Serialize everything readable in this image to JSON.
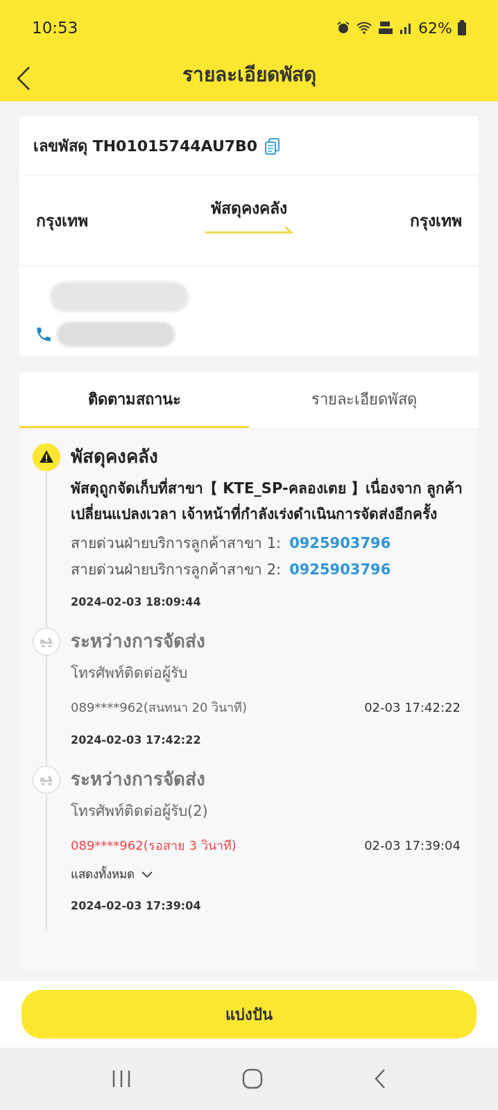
{
  "status_bar": {
    "time": "10:53",
    "battery": "62%"
  },
  "header": {
    "title": "รายละเอียดพัสดุ"
  },
  "parcel": {
    "label": "เลขพัสดุ",
    "number": "TH01015744AU7B0",
    "origin": "กรุงเทพ",
    "status": "พัสดุคงคลัง",
    "destination": "กรุงเทพ"
  },
  "tabs": [
    {
      "label": "ติดตามสถานะ",
      "selected": true
    },
    {
      "label": "รายละเอียดพัสดุ",
      "selected": false
    }
  ],
  "events": [
    {
      "kind": "warning",
      "active": true,
      "title": "พัสดุคงคลัง",
      "description": "พัสดุถูกจัดเก็บที่สาขา【 KTE_SP-คลองเตย 】เนื่องจาก ลูกค้าเปลี่ยนแปลงเวลา เจ้าหน้าที่กำลังเร่งดำเนินการจัดส่งอีกครั้ง",
      "hotlines": [
        {
          "label": "สายด่วนฝ่ายบริการลูกค้าสาขา 1:",
          "number": "0925903796"
        },
        {
          "label": "สายด่วนฝ่ายบริการลูกค้าสาขา 2:",
          "number": "0925903796"
        }
      ],
      "timestamp": "2024-02-03 18:09:44"
    },
    {
      "kind": "delivery",
      "active": false,
      "title": "ระหว่างการจัดส่ง",
      "description": "โทรศัพท์ติดต่อผู้รับ",
      "calls": [
        {
          "text": "089****962(สนทนา 20 วินาที)",
          "time": "02-03 17:42:22",
          "missed": false
        }
      ],
      "timestamp": "2024-02-03 17:42:22"
    },
    {
      "kind": "delivery",
      "active": false,
      "title": "ระหว่างการจัดส่ง",
      "description": "โทรศัพท์ติดต่อผู้รับ(2)",
      "calls": [
        {
          "text": "089****962(รอสาย 3 วินาที)",
          "time": "02-03 17:39:04",
          "missed": true
        }
      ],
      "show_all": "แสดงทั้งหมด",
      "timestamp": "2024-02-03 17:39:04"
    }
  ],
  "button": {
    "label": "แบ่งปัน"
  }
}
